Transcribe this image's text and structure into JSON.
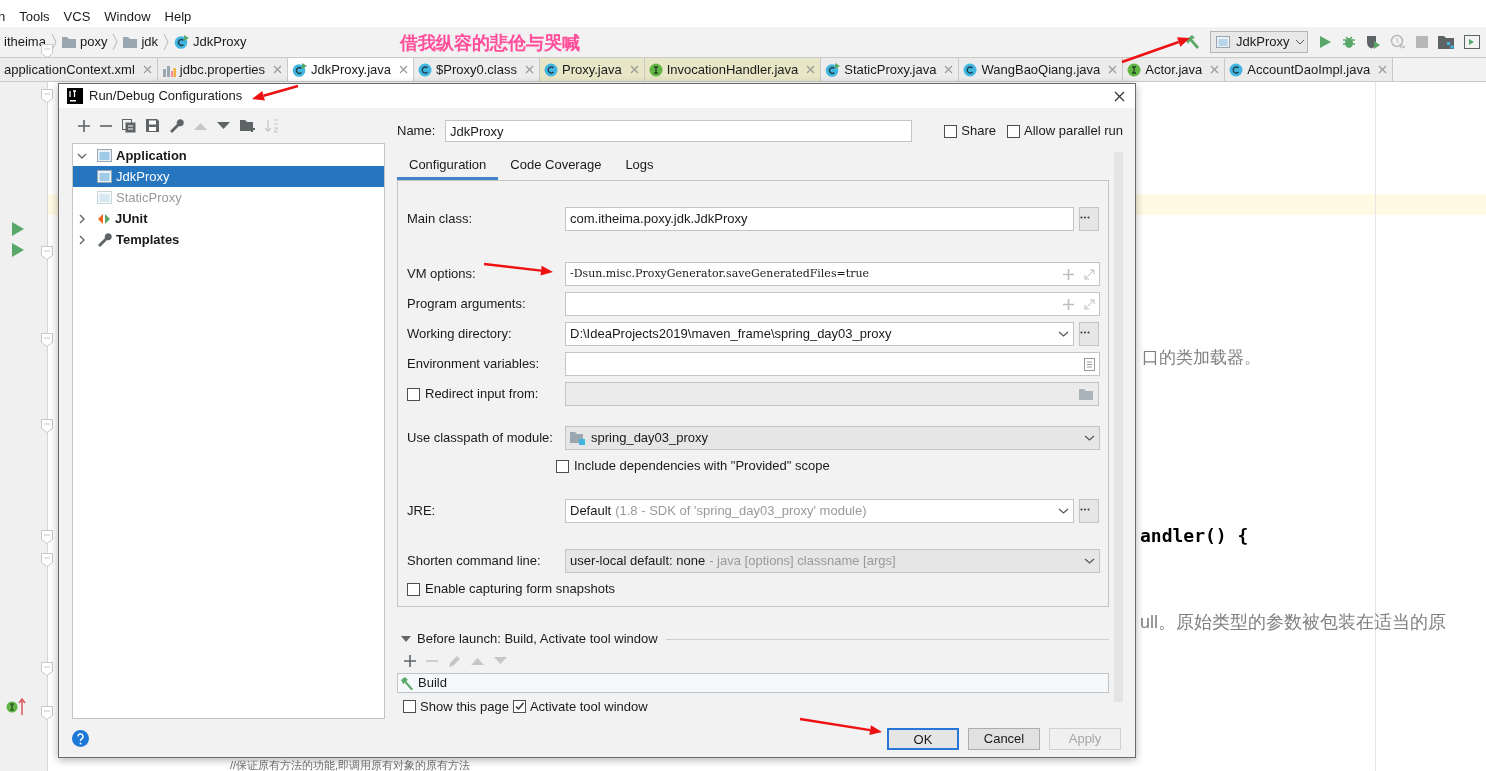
{
  "menu_bar": [
    {
      "label": "n"
    },
    {
      "label": "Tools"
    },
    {
      "label": "VCS"
    },
    {
      "label": "Window"
    },
    {
      "label": "Help"
    }
  ],
  "annotation_text": "借我纵容的悲伧与哭喊",
  "breadcrumbs": [
    {
      "label": "itheima",
      "kind": "plain"
    },
    {
      "label": "poxy",
      "kind": "folder"
    },
    {
      "label": "jdk",
      "kind": "folder"
    },
    {
      "label": "JdkProxy",
      "kind": "runnable-class"
    }
  ],
  "run_config": {
    "label": "JdkProxy"
  },
  "run_toolbar": [
    {
      "kind": "run",
      "disabled": false
    },
    {
      "kind": "debug",
      "disabled": false
    },
    {
      "kind": "coverage",
      "disabled": false
    },
    {
      "kind": "profile",
      "disabled": true
    },
    {
      "kind": "stop",
      "disabled": true
    },
    {
      "kind": "structure",
      "disabled": false
    },
    {
      "kind": "panel",
      "disabled": false
    }
  ],
  "editor_tabs": [
    {
      "label": "applicationContext.xml",
      "kind": "none",
      "selected": false,
      "library": false
    },
    {
      "label": "jdbc.properties",
      "kind": "properties",
      "selected": false,
      "library": false
    },
    {
      "label": "JdkProxy.java",
      "kind": "runnable-class",
      "selected": true,
      "library": false
    },
    {
      "label": "$Proxy0.class",
      "kind": "class",
      "selected": false,
      "library": false
    },
    {
      "label": "Proxy.java",
      "kind": "class",
      "selected": false,
      "library": true
    },
    {
      "label": "InvocationHandler.java",
      "kind": "interface",
      "selected": false,
      "library": true
    },
    {
      "label": "StaticProxy.java",
      "kind": "runnable-class",
      "selected": false,
      "library": false
    },
    {
      "label": "WangBaoQiang.java",
      "kind": "class",
      "selected": false,
      "library": false
    },
    {
      "label": "Actor.java",
      "kind": "interface",
      "selected": false,
      "library": false
    },
    {
      "label": "AccountDaoImpl.java",
      "kind": "class",
      "selected": false,
      "library": false
    }
  ],
  "code_fragments": [
    {
      "text": "口的类加载器。",
      "kind": "comment"
    },
    {
      "text": "andler() {",
      "kind": "code"
    },
    {
      "text": "ull。原始类型的参数被包装在适当的原",
      "kind": "comment"
    },
    {
      "text": "//保证原有方法的功能,即调用原有对象的原有方法",
      "kind": "comment"
    }
  ],
  "dialog": {
    "title": "Run/Debug Configurations",
    "toolbar": [
      {
        "kind": "add",
        "disabled": false
      },
      {
        "kind": "remove",
        "disabled": false
      },
      {
        "kind": "copy",
        "disabled": false
      },
      {
        "kind": "save",
        "disabled": false
      },
      {
        "kind": "edit-defaults",
        "disabled": false
      },
      {
        "kind": "up",
        "disabled": true
      },
      {
        "kind": "down",
        "disabled": false
      },
      {
        "kind": "new-folder",
        "disabled": false
      },
      {
        "kind": "sort",
        "disabled": true
      }
    ],
    "tree": [
      {
        "label": "Application",
        "kind": "application",
        "expanded": true,
        "children": [
          {
            "label": "JdkProxy",
            "kind": "application",
            "selected": true,
            "temporary": false
          },
          {
            "label": "StaticProxy",
            "kind": "application",
            "selected": false,
            "temporary": true
          }
        ]
      },
      {
        "label": "JUnit",
        "kind": "junit",
        "expanded": false
      },
      {
        "label": "Templates",
        "kind": "templates",
        "expanded": false
      }
    ],
    "name_label": "Name:",
    "name_value": "JdkProxy",
    "share": {
      "label": "Share",
      "checked": false
    },
    "parallel": {
      "label": "Allow parallel run",
      "checked": false
    },
    "tabs": [
      {
        "label": "Configuration",
        "selected": true
      },
      {
        "label": "Code Coverage",
        "selected": false
      },
      {
        "label": "Logs",
        "selected": false
      }
    ],
    "sections": [
      [
        {
          "kind": "text",
          "label": "Main class:",
          "value": "com.itheima.poxy.jdk.JdkProxy"
        }
      ],
      [
        {
          "kind": "expandable",
          "label": "VM options:",
          "value": "-Dsun.misc.ProxyGenerator.saveGeneratedFiles=true"
        },
        {
          "kind": "expandable",
          "label": "Program arguments:"
        },
        {
          "kind": "directory",
          "label": "Working directory:",
          "value": "D:\\IdeaProjects2019\\maven_frame\\spring_day03_proxy"
        },
        {
          "kind": "environment",
          "label": "Environment variables:"
        },
        {
          "kind": "redirect",
          "label": "Redirect input from:",
          "checked": false
        }
      ],
      [
        {
          "kind": "module",
          "label": "Use classpath of module:",
          "value": "spring_day03_proxy"
        },
        {
          "kind": "checkbox",
          "label": "Include dependencies with \"Provided\" scope",
          "checked": false
        }
      ],
      [
        {
          "kind": "jre",
          "label": "JRE:",
          "value": "Default",
          "hint": "(1.8 - SDK of 'spring_day03_proxy' module)"
        }
      ],
      [
        {
          "kind": "select",
          "label": "Shorten command line:",
          "value": "user-local default: none",
          "hint": "- java [options] classname [args]"
        },
        {
          "kind": "form-checkbox",
          "label": "Enable capturing form snapshots",
          "checked": false
        }
      ]
    ],
    "before_launch": {
      "title": "Before launch: Build, Activate tool window",
      "expanded": true,
      "toolbar": [
        {
          "kind": "add",
          "disabled": false
        },
        {
          "kind": "remove",
          "disabled": true
        },
        {
          "kind": "edit",
          "disabled": true
        },
        {
          "kind": "up",
          "disabled": true
        },
        {
          "kind": "down",
          "disabled": true
        }
      ],
      "tasks": [
        {
          "label": "Build"
        }
      ],
      "show_page": {
        "label": "Show this page",
        "checked": false
      },
      "activate": {
        "label": "Activate tool window",
        "checked": true
      }
    },
    "buttons": [
      {
        "label": "OK",
        "kind": "default",
        "disabled": false
      },
      {
        "label": "Cancel",
        "kind": "normal",
        "disabled": false
      },
      {
        "label": "Apply",
        "kind": "normal",
        "disabled": true
      }
    ]
  }
}
